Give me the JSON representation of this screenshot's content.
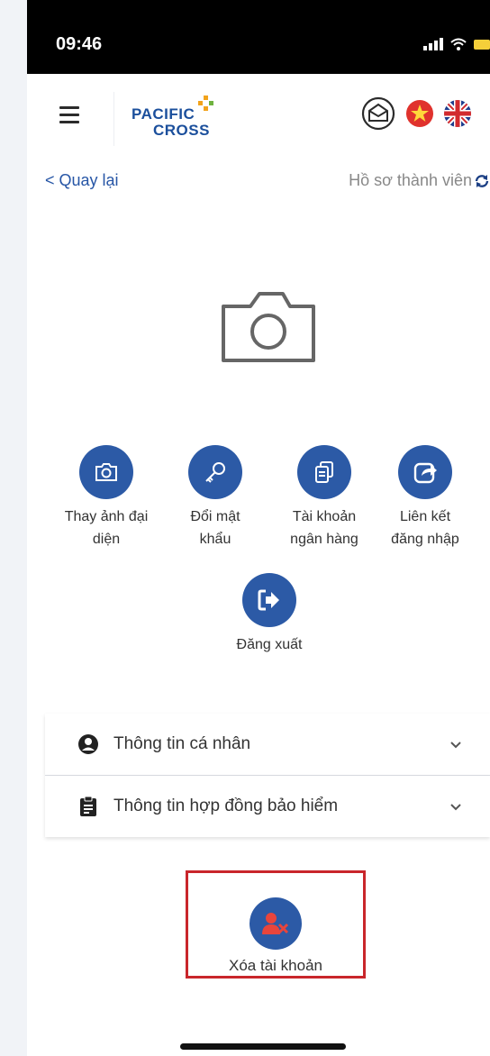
{
  "status_bar": {
    "time": "09:46"
  },
  "header": {
    "logo_line1": "PACIFIC",
    "logo_line2": "CROSS",
    "icons": [
      "mail-icon",
      "vietnam-flag-icon",
      "uk-flag-icon"
    ]
  },
  "nav": {
    "back_label": "< Quay lại",
    "title": "Hồ sơ thành viên"
  },
  "actions": [
    {
      "label": "Thay ảnh đại\ndiện",
      "icon": "camera-icon"
    },
    {
      "label": "Đổi mật\nkhẩu",
      "icon": "key-icon"
    },
    {
      "label": "Tài khoản\nngân hàng",
      "icon": "copy-documents-icon"
    },
    {
      "label": "Liên kết\nđăng nhập",
      "icon": "share-link-icon"
    },
    {
      "label": "Đăng xuất",
      "icon": "logout-icon"
    }
  ],
  "sections": [
    {
      "label": "Thông tin cá nhân",
      "icon": "user-circle-icon"
    },
    {
      "label": "Thông tin hợp đồng bảo hiểm",
      "icon": "clipboard-icon"
    }
  ],
  "delete_account": {
    "label": "Xóa tài khoản",
    "icon": "delete-user-icon"
  },
  "colors": {
    "primary": "#2c5aa6",
    "highlight_border": "#c9262b",
    "delete_icon_accent": "#e8453c"
  }
}
